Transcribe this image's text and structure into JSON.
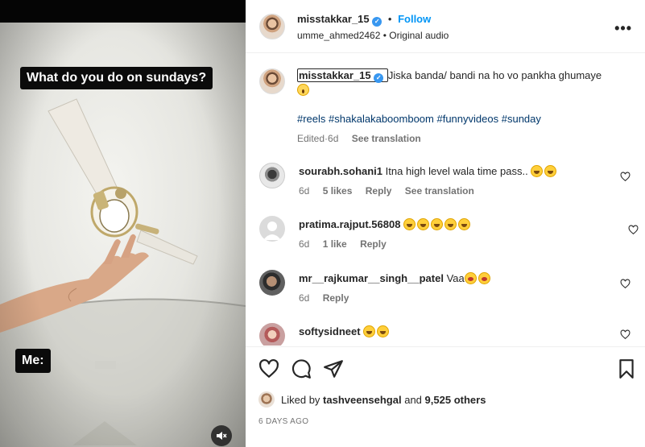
{
  "media": {
    "caption_top": "What do you do on sundays?",
    "caption_bottom": "Me:",
    "mute_icon": "speaker-muted-icon"
  },
  "header": {
    "username": "misstakkar_15",
    "verified_icon": "verified-badge-icon",
    "separator": "•",
    "follow_label": "Follow",
    "audio_user": "umme_ahmed2462",
    "audio_separator": "•",
    "audio_label": "Original audio",
    "more_icon": "more-options-icon",
    "more_glyph": "•••"
  },
  "post_caption": {
    "username": "misstakkar_15",
    "text": "Jiska banda/ bandi na ho vo pankha ghumaye",
    "hashtags": [
      "#reels",
      "#shakalakaboomboom",
      "#funnyvideos",
      "#sunday"
    ],
    "edited_label": "Edited",
    "meta_separator": "·",
    "age": "6d",
    "see_translation": "See translation"
  },
  "comments": [
    {
      "username": "sourabh.sohani1",
      "text": "Itna high level wala time pass..",
      "age": "6d",
      "likes": "5 likes",
      "reply": "Reply",
      "see_translation": "See translation"
    },
    {
      "username": "pratima.rajput.56808",
      "text": "",
      "age": "6d",
      "likes": "1 like",
      "reply": "Reply"
    },
    {
      "username": "mr__rajkumar__singh__patel",
      "text": "Vaa",
      "age": "6d",
      "reply": "Reply"
    },
    {
      "username": "softysidneet",
      "text": ""
    }
  ],
  "actions": {
    "like_icon": "heart-icon",
    "comment_icon": "comment-bubble-icon",
    "share_icon": "share-paper-plane-icon",
    "save_icon": "bookmark-icon"
  },
  "likes": {
    "prefix": "Liked by",
    "user": "tashveensehgal",
    "and": "and",
    "count_text": "9,525 others"
  },
  "date": "6 DAYS AGO",
  "colors": {
    "follow_blue": "#0095f6",
    "verified_blue": "#3897f0",
    "hashtag": "#00376b",
    "muted_text": "#737373"
  }
}
